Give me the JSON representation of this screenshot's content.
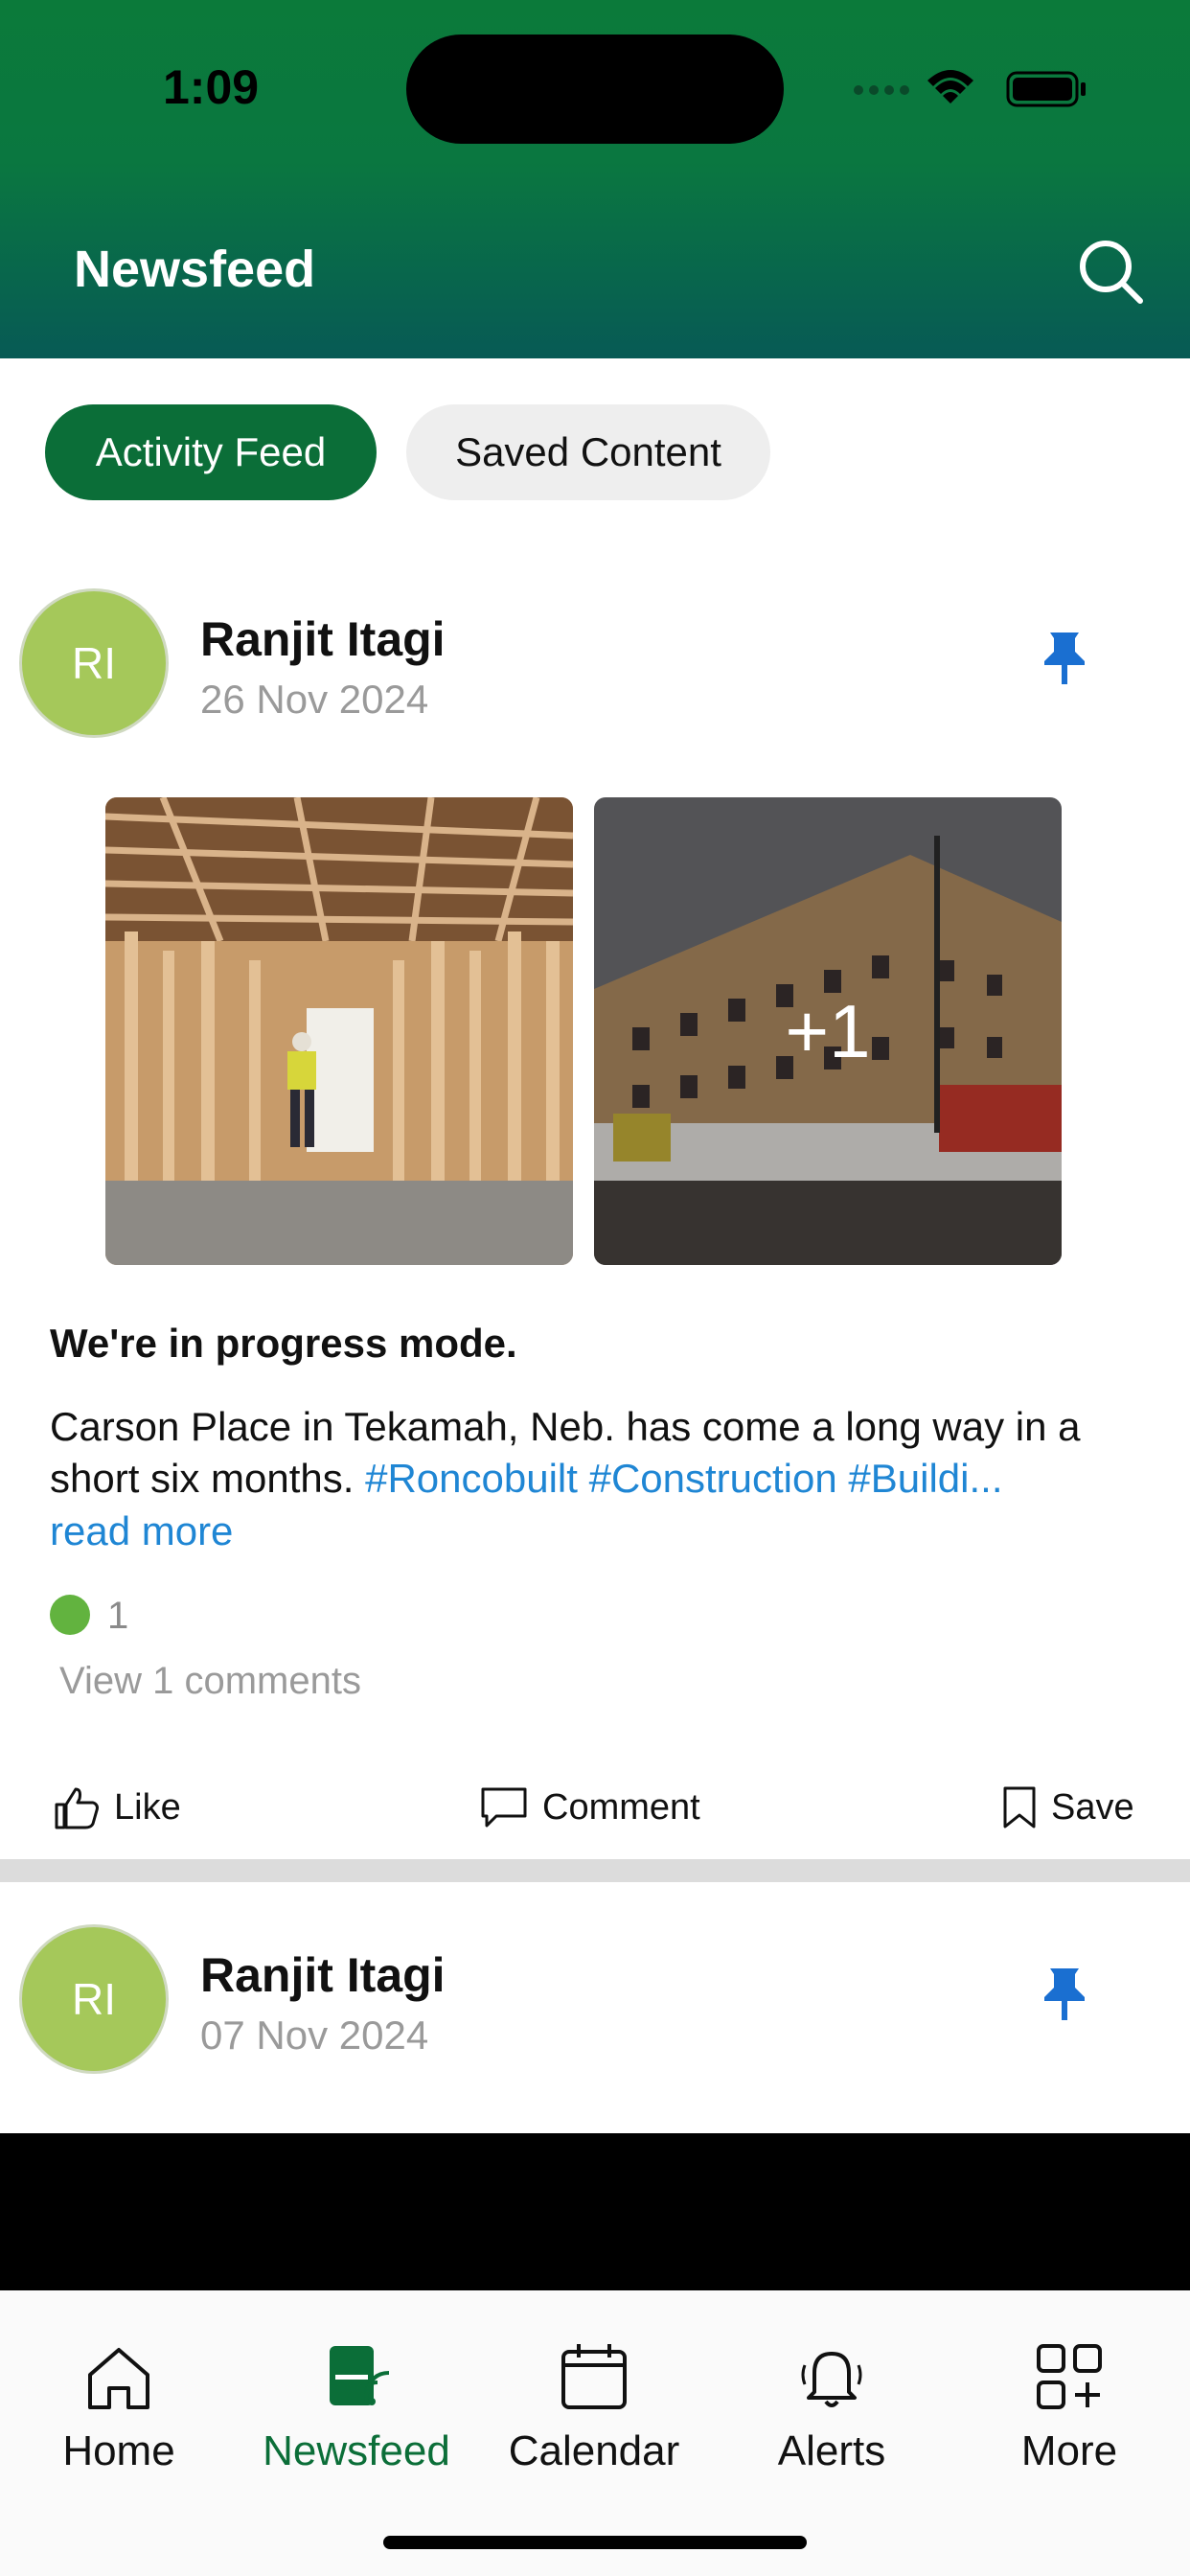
{
  "status": {
    "time": "1:09"
  },
  "header": {
    "title": "Newsfeed",
    "search_icon": "search-icon"
  },
  "tabs": [
    {
      "label": "Activity Feed",
      "active": true
    },
    {
      "label": "Saved Content",
      "active": false
    }
  ],
  "posts": [
    {
      "avatar_initials": "RI",
      "author": "Ranjit Itagi",
      "date": "26 Nov 2024",
      "pinned": true,
      "image_more_count": "+1",
      "title": "We're in progress mode.",
      "body_text": "Carson Place in Tekamah, Neb. has come a long way in a short six months. ",
      "body_tags": "#Roncobuilt #Construction #Buildi...",
      "read_more": "read more",
      "reaction_count": "1",
      "view_comments": "View 1 comments",
      "actions": {
        "like": "Like",
        "comment": "Comment",
        "save": "Save"
      }
    },
    {
      "avatar_initials": "RI",
      "author": "Ranjit Itagi",
      "date": "07 Nov 2024",
      "pinned": true
    }
  ],
  "bottom_nav": [
    {
      "label": "Home",
      "icon": "home-icon",
      "active": false
    },
    {
      "label": "Newsfeed",
      "icon": "newsfeed-icon",
      "active": true
    },
    {
      "label": "Calendar",
      "icon": "calendar-icon",
      "active": false
    },
    {
      "label": "Alerts",
      "icon": "bell-icon",
      "active": false
    },
    {
      "label": "More",
      "icon": "grid-plus-icon",
      "active": false
    }
  ],
  "colors": {
    "brand_green": "#0b6e38",
    "link_blue": "#1f86d4",
    "avatar_green": "#a5c85a"
  }
}
